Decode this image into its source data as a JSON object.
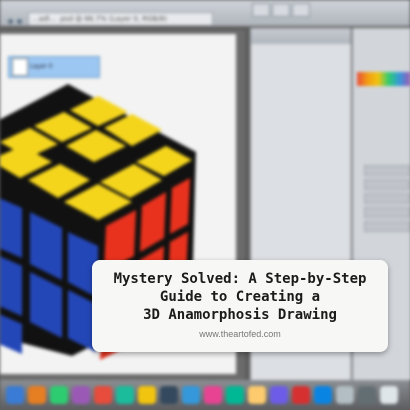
{
  "window": {
    "document_tab": "...adl... .psd @ 66.7% (Layer 0, RGB/8)"
  },
  "layers_panel": {
    "layer_name": "Layer 0"
  },
  "caption": {
    "title_lines": [
      "Mystery Solved: A Step-by-Step",
      "Guide to Creating a",
      "3D Anamorphosis Drawing"
    ],
    "url": "www.theartofed.com"
  },
  "colors": {
    "cube_yellow": "#f5d51c",
    "cube_red": "#e8321e",
    "cube_blue": "#2447b8",
    "cube_gap": "#111111",
    "layer_highlight": "#9cc7f2"
  },
  "icons": {
    "dock": [
      "finder-icon",
      "app-icon",
      "app-icon",
      "app-icon",
      "app-icon",
      "app-icon",
      "app-icon",
      "app-icon",
      "app-icon",
      "app-icon",
      "app-icon",
      "app-icon",
      "app-icon",
      "app-icon",
      "app-icon",
      "app-icon",
      "app-icon",
      "trash-icon"
    ]
  }
}
